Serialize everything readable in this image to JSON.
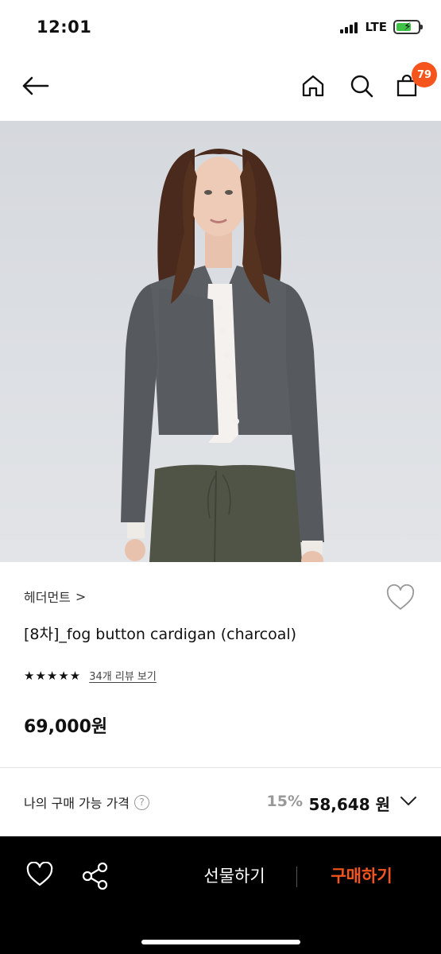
{
  "status_bar": {
    "time": "12:01",
    "network": "LTE",
    "icons": [
      "signal-icon",
      "battery-charging-icon"
    ]
  },
  "nav": {
    "icons": [
      "back-arrow-icon",
      "home-icon",
      "search-icon",
      "shopping-bag-icon"
    ],
    "cart_count": "79"
  },
  "product": {
    "brand": "헤더먼트",
    "brand_chevron": ">",
    "title": "[8차]_fog button cardigan (charcoal)",
    "stars": "★★★★★",
    "rating_value": 5,
    "review_link": "34개 리뷰 보기",
    "price": "69,000원"
  },
  "my_price": {
    "label": "나의 구매 가능 가격",
    "help_glyph": "?",
    "discount": "15%",
    "discounted_price": "58,648 원"
  },
  "bottom_bar": {
    "gift_label": "선물하기",
    "buy_label": "구매하기",
    "icons": [
      "heart-icon",
      "share-icon"
    ]
  },
  "colors": {
    "accent": "#f5541d",
    "bottom_bar_bg": "#000000",
    "muted": "#999999"
  }
}
